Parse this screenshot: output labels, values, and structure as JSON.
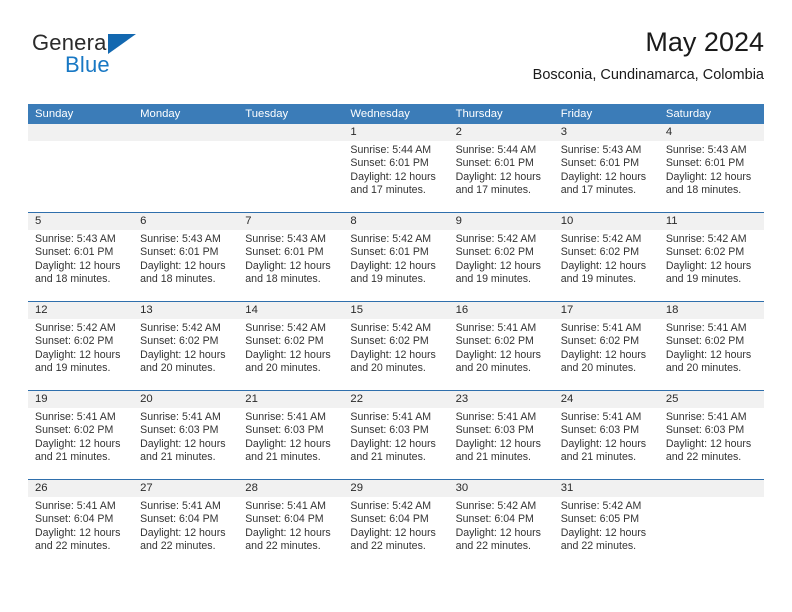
{
  "brand": {
    "name_part1": "General",
    "name_part2": "Blue",
    "triangle_color": "#1368b0",
    "blue_color": "#1878c4"
  },
  "header": {
    "month_title": "May 2024",
    "location": "Bosconia, Cundinamarca, Colombia"
  },
  "calendar": {
    "header_bg": "#3b7cb8",
    "daynum_bg": "#f1f1f1",
    "week_separator_color": "#2f6fac",
    "weekdays": [
      "Sunday",
      "Monday",
      "Tuesday",
      "Wednesday",
      "Thursday",
      "Friday",
      "Saturday"
    ],
    "weeks": [
      [
        {
          "day": "",
          "lines": []
        },
        {
          "day": "",
          "lines": []
        },
        {
          "day": "",
          "lines": []
        },
        {
          "day": "1",
          "lines": [
            "Sunrise: 5:44 AM",
            "Sunset: 6:01 PM",
            "Daylight: 12 hours",
            "and 17 minutes."
          ]
        },
        {
          "day": "2",
          "lines": [
            "Sunrise: 5:44 AM",
            "Sunset: 6:01 PM",
            "Daylight: 12 hours",
            "and 17 minutes."
          ]
        },
        {
          "day": "3",
          "lines": [
            "Sunrise: 5:43 AM",
            "Sunset: 6:01 PM",
            "Daylight: 12 hours",
            "and 17 minutes."
          ]
        },
        {
          "day": "4",
          "lines": [
            "Sunrise: 5:43 AM",
            "Sunset: 6:01 PM",
            "Daylight: 12 hours",
            "and 18 minutes."
          ]
        }
      ],
      [
        {
          "day": "5",
          "lines": [
            "Sunrise: 5:43 AM",
            "Sunset: 6:01 PM",
            "Daylight: 12 hours",
            "and 18 minutes."
          ]
        },
        {
          "day": "6",
          "lines": [
            "Sunrise: 5:43 AM",
            "Sunset: 6:01 PM",
            "Daylight: 12 hours",
            "and 18 minutes."
          ]
        },
        {
          "day": "7",
          "lines": [
            "Sunrise: 5:43 AM",
            "Sunset: 6:01 PM",
            "Daylight: 12 hours",
            "and 18 minutes."
          ]
        },
        {
          "day": "8",
          "lines": [
            "Sunrise: 5:42 AM",
            "Sunset: 6:01 PM",
            "Daylight: 12 hours",
            "and 19 minutes."
          ]
        },
        {
          "day": "9",
          "lines": [
            "Sunrise: 5:42 AM",
            "Sunset: 6:02 PM",
            "Daylight: 12 hours",
            "and 19 minutes."
          ]
        },
        {
          "day": "10",
          "lines": [
            "Sunrise: 5:42 AM",
            "Sunset: 6:02 PM",
            "Daylight: 12 hours",
            "and 19 minutes."
          ]
        },
        {
          "day": "11",
          "lines": [
            "Sunrise: 5:42 AM",
            "Sunset: 6:02 PM",
            "Daylight: 12 hours",
            "and 19 minutes."
          ]
        }
      ],
      [
        {
          "day": "12",
          "lines": [
            "Sunrise: 5:42 AM",
            "Sunset: 6:02 PM",
            "Daylight: 12 hours",
            "and 19 minutes."
          ]
        },
        {
          "day": "13",
          "lines": [
            "Sunrise: 5:42 AM",
            "Sunset: 6:02 PM",
            "Daylight: 12 hours",
            "and 20 minutes."
          ]
        },
        {
          "day": "14",
          "lines": [
            "Sunrise: 5:42 AM",
            "Sunset: 6:02 PM",
            "Daylight: 12 hours",
            "and 20 minutes."
          ]
        },
        {
          "day": "15",
          "lines": [
            "Sunrise: 5:42 AM",
            "Sunset: 6:02 PM",
            "Daylight: 12 hours",
            "and 20 minutes."
          ]
        },
        {
          "day": "16",
          "lines": [
            "Sunrise: 5:41 AM",
            "Sunset: 6:02 PM",
            "Daylight: 12 hours",
            "and 20 minutes."
          ]
        },
        {
          "day": "17",
          "lines": [
            "Sunrise: 5:41 AM",
            "Sunset: 6:02 PM",
            "Daylight: 12 hours",
            "and 20 minutes."
          ]
        },
        {
          "day": "18",
          "lines": [
            "Sunrise: 5:41 AM",
            "Sunset: 6:02 PM",
            "Daylight: 12 hours",
            "and 20 minutes."
          ]
        }
      ],
      [
        {
          "day": "19",
          "lines": [
            "Sunrise: 5:41 AM",
            "Sunset: 6:02 PM",
            "Daylight: 12 hours",
            "and 21 minutes."
          ]
        },
        {
          "day": "20",
          "lines": [
            "Sunrise: 5:41 AM",
            "Sunset: 6:03 PM",
            "Daylight: 12 hours",
            "and 21 minutes."
          ]
        },
        {
          "day": "21",
          "lines": [
            "Sunrise: 5:41 AM",
            "Sunset: 6:03 PM",
            "Daylight: 12 hours",
            "and 21 minutes."
          ]
        },
        {
          "day": "22",
          "lines": [
            "Sunrise: 5:41 AM",
            "Sunset: 6:03 PM",
            "Daylight: 12 hours",
            "and 21 minutes."
          ]
        },
        {
          "day": "23",
          "lines": [
            "Sunrise: 5:41 AM",
            "Sunset: 6:03 PM",
            "Daylight: 12 hours",
            "and 21 minutes."
          ]
        },
        {
          "day": "24",
          "lines": [
            "Sunrise: 5:41 AM",
            "Sunset: 6:03 PM",
            "Daylight: 12 hours",
            "and 21 minutes."
          ]
        },
        {
          "day": "25",
          "lines": [
            "Sunrise: 5:41 AM",
            "Sunset: 6:03 PM",
            "Daylight: 12 hours",
            "and 22 minutes."
          ]
        }
      ],
      [
        {
          "day": "26",
          "lines": [
            "Sunrise: 5:41 AM",
            "Sunset: 6:04 PM",
            "Daylight: 12 hours",
            "and 22 minutes."
          ]
        },
        {
          "day": "27",
          "lines": [
            "Sunrise: 5:41 AM",
            "Sunset: 6:04 PM",
            "Daylight: 12 hours",
            "and 22 minutes."
          ]
        },
        {
          "day": "28",
          "lines": [
            "Sunrise: 5:41 AM",
            "Sunset: 6:04 PM",
            "Daylight: 12 hours",
            "and 22 minutes."
          ]
        },
        {
          "day": "29",
          "lines": [
            "Sunrise: 5:42 AM",
            "Sunset: 6:04 PM",
            "Daylight: 12 hours",
            "and 22 minutes."
          ]
        },
        {
          "day": "30",
          "lines": [
            "Sunrise: 5:42 AM",
            "Sunset: 6:04 PM",
            "Daylight: 12 hours",
            "and 22 minutes."
          ]
        },
        {
          "day": "31",
          "lines": [
            "Sunrise: 5:42 AM",
            "Sunset: 6:05 PM",
            "Daylight: 12 hours",
            "and 22 minutes."
          ]
        },
        {
          "day": "",
          "lines": []
        }
      ]
    ]
  }
}
